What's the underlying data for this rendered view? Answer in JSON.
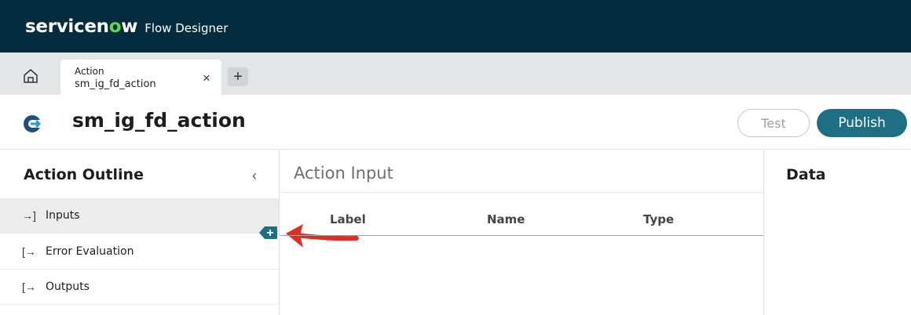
{
  "brand": {
    "logo_left": "servicen",
    "logo_o": "o",
    "logo_right": "w",
    "app_name": "Flow Designer"
  },
  "tabs": [
    {
      "title": "Action",
      "subtitle": "sm_ig_fd_action",
      "close": "×"
    }
  ],
  "add_tab": "+",
  "header": {
    "title": "sm_ig_fd_action",
    "test_label": "Test",
    "publish_label": "Publish"
  },
  "outline": {
    "title": "Action Outline",
    "collapse": "‹",
    "items": [
      {
        "label": "Inputs",
        "icon": "→]"
      },
      {
        "label": "Error Evaluation",
        "icon": "[→"
      },
      {
        "label": "Outputs",
        "icon": "[→"
      }
    ]
  },
  "action_input": {
    "title": "Action Input",
    "columns": [
      "Label",
      "Name",
      "Type"
    ]
  },
  "data_panel": {
    "title": "Data"
  },
  "icons": {
    "home": "home-icon",
    "action": "action-icon",
    "add": "plus-icon",
    "annotation": "arrow-icon"
  },
  "colors": {
    "topbar": "#032c3f",
    "brand_accent": "#62d84e",
    "primary": "#1f6f84",
    "annotation": "#e32b20"
  }
}
